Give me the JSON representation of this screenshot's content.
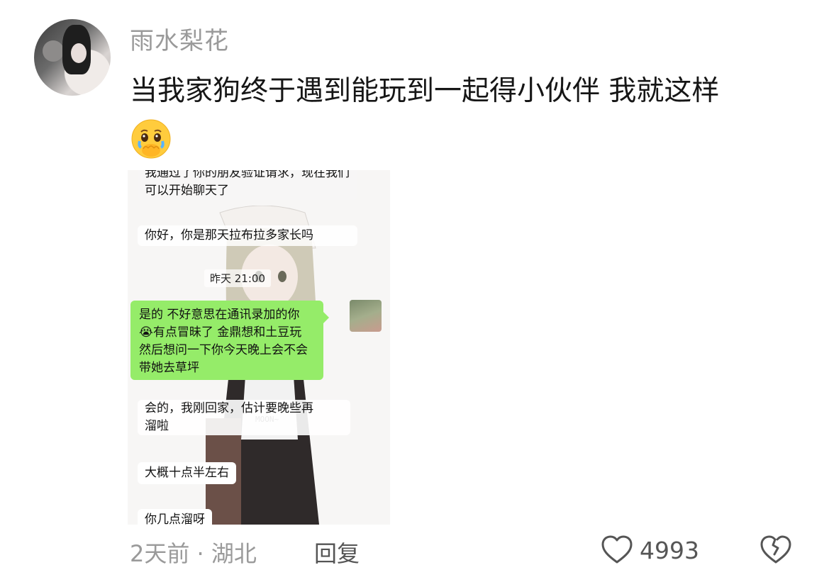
{
  "comment": {
    "username": "雨水梨花",
    "text": "当我家狗终于遇到能玩到一起得小伙伴 我就这样",
    "emoji": "🥹"
  },
  "screenshot": {
    "chat": {
      "msg1": "我通过了你的朋友验证请求，现在我们可以开始聊天了",
      "msg2": "你好，你是那天拉布拉多家长吗",
      "timestamp": "昨天 21:00",
      "reply_line1": "是的 不好意思在通讯录加的你",
      "reply_line2": "😭有点冒昧了 金鼎想和土豆玩",
      "reply_line3": "然后想问一下你今天晚上会不会",
      "reply_line4": "带她去草坪",
      "msg3_line1": "会的，我刚回家，估计要晚些再",
      "msg3_line2": "溜啦",
      "msg4": "大概十点半左右",
      "msg5": "你几点溜呀"
    }
  },
  "footer": {
    "meta": "2天前 · 湖北",
    "reply": "回复",
    "like_count": "4993"
  }
}
